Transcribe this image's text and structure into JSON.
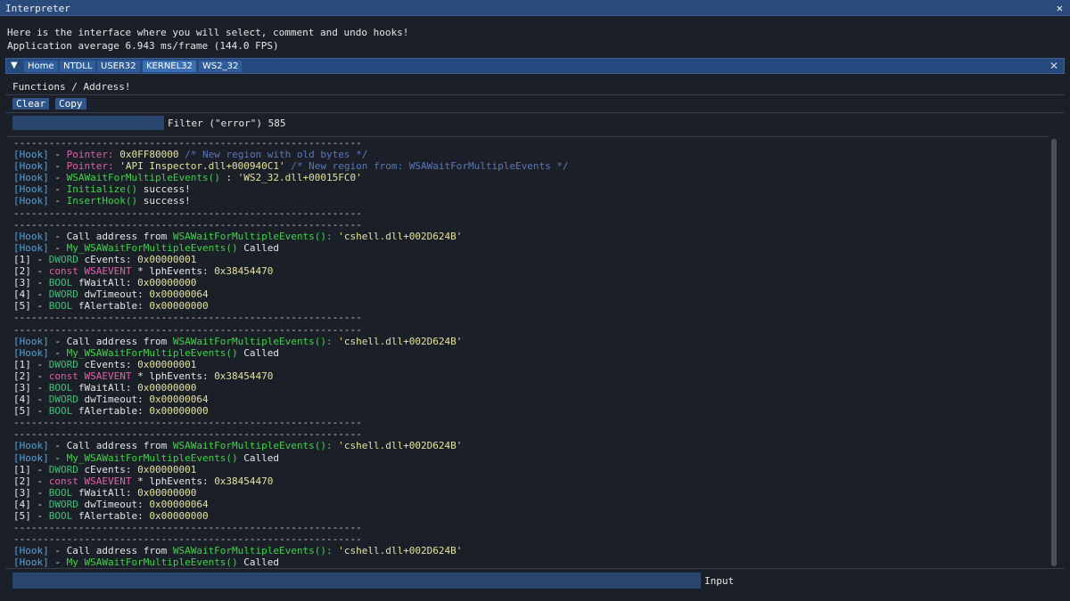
{
  "window": {
    "title": "Interpreter",
    "close_glyph": "✕"
  },
  "intro": {
    "line1": "Here is the interface where you will select, comment and undo hooks!",
    "line2": "Application average 6.943 ms/frame (144.0 FPS)"
  },
  "tabs": {
    "menu_glyph": "▼",
    "items": [
      "Home",
      "NTDLL",
      "USER32",
      "KERNEL32",
      "WS2_32"
    ],
    "close_glyph": "✕"
  },
  "section": {
    "label": "Functions / Address!"
  },
  "buttons": {
    "clear": "Clear",
    "copy": "Copy"
  },
  "filter": {
    "label": "Filter (\"error\") 585",
    "value": ""
  },
  "input": {
    "label": "Input",
    "value": ""
  },
  "colors": {
    "hook": "#4fa3e0",
    "pointer": "#e060a8",
    "value": "#e3e3a0",
    "comment": "#5a78b8",
    "function": "#3fd24a",
    "type": "#3fbf7a"
  },
  "log": [
    [
      [
        "c-sep",
        "-----------------------------------------------------------"
      ]
    ],
    [
      [
        "c-hook",
        "[Hook]"
      ],
      [
        "c-white",
        " - "
      ],
      [
        "c-pink",
        "Pointer:"
      ],
      [
        "c-num",
        " 0x0FF80000"
      ],
      [
        "c-comment",
        " /* New region with old bytes */"
      ]
    ],
    [
      [
        "c-hook",
        "[Hook]"
      ],
      [
        "c-white",
        " - "
      ],
      [
        "c-pink",
        "Pointer:"
      ],
      [
        "c-num",
        " 'API Inspector.dll+000940C1'"
      ],
      [
        "c-comment",
        " /* New region from: WSAWaitForMultipleEvents */"
      ]
    ],
    [
      [
        "c-hook",
        "[Hook]"
      ],
      [
        "c-white",
        " - "
      ],
      [
        "c-green",
        "WSAWaitForMultipleEvents()"
      ],
      [
        "c-white",
        " : "
      ],
      [
        "c-num",
        "'WS2_32.dll+00015FC0'"
      ]
    ],
    [
      [
        "c-hook",
        "[Hook]"
      ],
      [
        "c-white",
        " - "
      ],
      [
        "c-green",
        "Initialize()"
      ],
      [
        "c-white",
        " success!"
      ]
    ],
    [
      [
        "c-hook",
        "[Hook]"
      ],
      [
        "c-white",
        " - "
      ],
      [
        "c-green",
        "InsertHook()"
      ],
      [
        "c-white",
        " success!"
      ]
    ],
    [
      [
        "c-sep",
        "-----------------------------------------------------------"
      ]
    ],
    [
      [
        "c-sep",
        "-----------------------------------------------------------"
      ]
    ],
    [
      [
        "c-hook",
        "[Hook]"
      ],
      [
        "c-white",
        " - Call address from "
      ],
      [
        "c-green",
        "WSAWaitForMultipleEvents():"
      ],
      [
        "c-num",
        " 'cshell.dll+002D624B'"
      ]
    ],
    [
      [
        "c-hook",
        "[Hook]"
      ],
      [
        "c-white",
        " - "
      ],
      [
        "c-green",
        "My_WSAWaitForMultipleEvents()"
      ],
      [
        "c-white",
        " Called"
      ]
    ],
    [
      [
        "c-white",
        "[1] - "
      ],
      [
        "c-type",
        "DWORD"
      ],
      [
        "c-white",
        " cEvents: "
      ],
      [
        "c-num",
        "0x00000001"
      ]
    ],
    [
      [
        "c-white",
        "[2] - "
      ],
      [
        "c-pink",
        "const WSAEVENT"
      ],
      [
        "c-white",
        " * lphEvents: "
      ],
      [
        "c-num",
        "0x38454470"
      ]
    ],
    [
      [
        "c-white",
        "[3] - "
      ],
      [
        "c-type",
        "BOOL"
      ],
      [
        "c-white",
        " fWaitAll: "
      ],
      [
        "c-num",
        "0x00000000"
      ]
    ],
    [
      [
        "c-white",
        "[4] - "
      ],
      [
        "c-type",
        "DWORD"
      ],
      [
        "c-white",
        " dwTimeout: "
      ],
      [
        "c-num",
        "0x00000064"
      ]
    ],
    [
      [
        "c-white",
        "[5] - "
      ],
      [
        "c-type",
        "BOOL"
      ],
      [
        "c-white",
        " fAlertable: "
      ],
      [
        "c-num",
        "0x00000000"
      ]
    ],
    [
      [
        "c-sep",
        "-----------------------------------------------------------"
      ]
    ],
    [
      [
        "c-sep",
        "-----------------------------------------------------------"
      ]
    ],
    [
      [
        "c-hook",
        "[Hook]"
      ],
      [
        "c-white",
        " - Call address from "
      ],
      [
        "c-green",
        "WSAWaitForMultipleEvents():"
      ],
      [
        "c-num",
        " 'cshell.dll+002D624B'"
      ]
    ],
    [
      [
        "c-hook",
        "[Hook]"
      ],
      [
        "c-white",
        " - "
      ],
      [
        "c-green",
        "My_WSAWaitForMultipleEvents()"
      ],
      [
        "c-white",
        " Called"
      ]
    ],
    [
      [
        "c-white",
        "[1] - "
      ],
      [
        "c-type",
        "DWORD"
      ],
      [
        "c-white",
        " cEvents: "
      ],
      [
        "c-num",
        "0x00000001"
      ]
    ],
    [
      [
        "c-white",
        "[2] - "
      ],
      [
        "c-pink",
        "const WSAEVENT"
      ],
      [
        "c-white",
        " * lphEvents: "
      ],
      [
        "c-num",
        "0x38454470"
      ]
    ],
    [
      [
        "c-white",
        "[3] - "
      ],
      [
        "c-type",
        "BOOL"
      ],
      [
        "c-white",
        " fWaitAll: "
      ],
      [
        "c-num",
        "0x00000000"
      ]
    ],
    [
      [
        "c-white",
        "[4] - "
      ],
      [
        "c-type",
        "DWORD"
      ],
      [
        "c-white",
        " dwTimeout: "
      ],
      [
        "c-num",
        "0x00000064"
      ]
    ],
    [
      [
        "c-white",
        "[5] - "
      ],
      [
        "c-type",
        "BOOL"
      ],
      [
        "c-white",
        " fAlertable: "
      ],
      [
        "c-num",
        "0x00000000"
      ]
    ],
    [
      [
        "c-sep",
        "-----------------------------------------------------------"
      ]
    ],
    [
      [
        "c-sep",
        "-----------------------------------------------------------"
      ]
    ],
    [
      [
        "c-hook",
        "[Hook]"
      ],
      [
        "c-white",
        " - Call address from "
      ],
      [
        "c-green",
        "WSAWaitForMultipleEvents():"
      ],
      [
        "c-num",
        " 'cshell.dll+002D624B'"
      ]
    ],
    [
      [
        "c-hook",
        "[Hook]"
      ],
      [
        "c-white",
        " - "
      ],
      [
        "c-green",
        "My_WSAWaitForMultipleEvents()"
      ],
      [
        "c-white",
        " Called"
      ]
    ],
    [
      [
        "c-white",
        "[1] - "
      ],
      [
        "c-type",
        "DWORD"
      ],
      [
        "c-white",
        " cEvents: "
      ],
      [
        "c-num",
        "0x00000001"
      ]
    ],
    [
      [
        "c-white",
        "[2] - "
      ],
      [
        "c-pink",
        "const WSAEVENT"
      ],
      [
        "c-white",
        " * lphEvents: "
      ],
      [
        "c-num",
        "0x38454470"
      ]
    ],
    [
      [
        "c-white",
        "[3] - "
      ],
      [
        "c-type",
        "BOOL"
      ],
      [
        "c-white",
        " fWaitAll: "
      ],
      [
        "c-num",
        "0x00000000"
      ]
    ],
    [
      [
        "c-white",
        "[4] - "
      ],
      [
        "c-type",
        "DWORD"
      ],
      [
        "c-white",
        " dwTimeout: "
      ],
      [
        "c-num",
        "0x00000064"
      ]
    ],
    [
      [
        "c-white",
        "[5] - "
      ],
      [
        "c-type",
        "BOOL"
      ],
      [
        "c-white",
        " fAlertable: "
      ],
      [
        "c-num",
        "0x00000000"
      ]
    ],
    [
      [
        "c-sep",
        "-----------------------------------------------------------"
      ]
    ],
    [
      [
        "c-sep",
        "-----------------------------------------------------------"
      ]
    ],
    [
      [
        "c-hook",
        "[Hook]"
      ],
      [
        "c-white",
        " - Call address from "
      ],
      [
        "c-green",
        "WSAWaitForMultipleEvents():"
      ],
      [
        "c-num",
        " 'cshell.dll+002D624B'"
      ]
    ],
    [
      [
        "c-hook",
        "[Hook]"
      ],
      [
        "c-white",
        " - "
      ],
      [
        "c-green",
        "My_WSAWaitForMultipleEvents()"
      ],
      [
        "c-white",
        " Called"
      ]
    ]
  ]
}
